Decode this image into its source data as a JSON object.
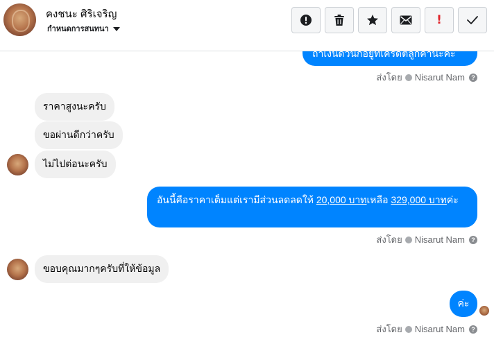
{
  "header": {
    "contact_name": "คงชนะ ศิริเจริญ",
    "subtitle": "กำหนดการสนทนา",
    "actions": [
      {
        "name": "report-icon"
      },
      {
        "name": "trash-icon"
      },
      {
        "name": "star-icon"
      },
      {
        "name": "envelope-icon"
      },
      {
        "name": "exclamation-icon",
        "label": "!",
        "color": "#e0242b"
      },
      {
        "name": "checkmark-icon"
      }
    ]
  },
  "messages": {
    "outgoing_1_partial": "ถ้าเงินด่วนก็อยู่ที่เครดิตลูกค้านะคะ",
    "seen_1": {
      "prefix": "ส่งโดย",
      "agent": "Nisarut Nam"
    },
    "incoming_1": "ราคาสูงนะครับ",
    "incoming_2": "ขอผ่านดีกว่าครับ",
    "incoming_3": "ไม่ไปต่อนะครับ",
    "outgoing_2": {
      "text_a": "อันนี้คือราคาเต็มแต่เรามีส่วนลดลดให้ ",
      "link_a": "20,000 บาท",
      "text_b": "เหลือ ",
      "link_b": "329,000 บาท",
      "text_c": "ค่ะ"
    },
    "seen_2": {
      "prefix": "ส่งโดย",
      "agent": "Nisarut Nam"
    },
    "incoming_4": "ขอบคุณมากๆครับที่ให้ข้อมูล",
    "outgoing_3": "ค่ะ",
    "seen_3": {
      "prefix": "ส่งโดย",
      "agent": "Nisarut Nam"
    }
  },
  "colors": {
    "outgoing_bubble": "#0084ff",
    "incoming_bubble": "#f0f0f0",
    "meta_text": "#65676b"
  }
}
